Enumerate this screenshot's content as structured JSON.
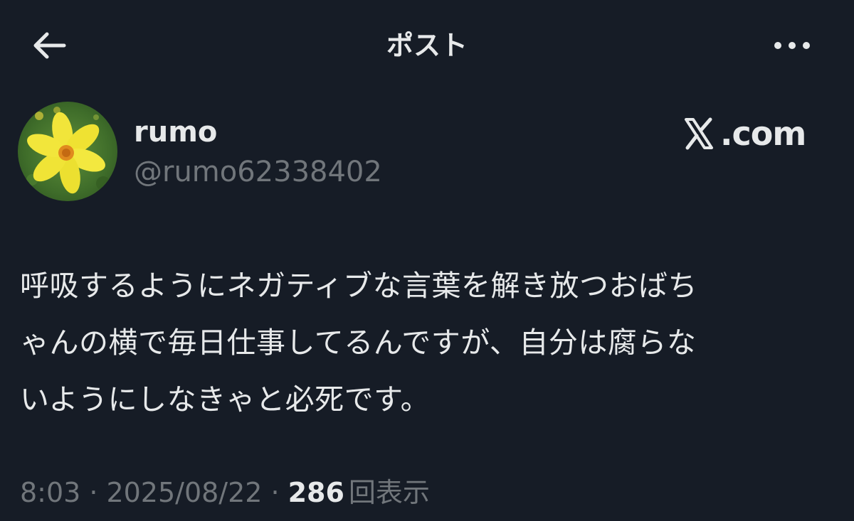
{
  "header": {
    "title": "ポスト",
    "back_icon": "arrow-left-icon",
    "more_icon": "more-horizontal-icon"
  },
  "author": {
    "display_name": "rumo",
    "handle": "@rumo62338402",
    "avatar": "yellow-cosmos-flower-photo"
  },
  "brand": {
    "logo_icon": "x-logo-icon",
    "text": ".com"
  },
  "post": {
    "lines": [
      "呼吸するようにネガティブな言葉を解き放つおばち",
      "ゃんの横で毎日仕事してるんですが、自分は腐らな",
      "いようにしなきゃと必死です。"
    ]
  },
  "meta": {
    "time": "8:03",
    "separator": "·",
    "date": "2025/08/22",
    "views_count": "286",
    "views_label": "回表示"
  },
  "colors": {
    "background": "#161c26",
    "text_primary": "#e7e9ea",
    "text_secondary": "#71767b"
  }
}
